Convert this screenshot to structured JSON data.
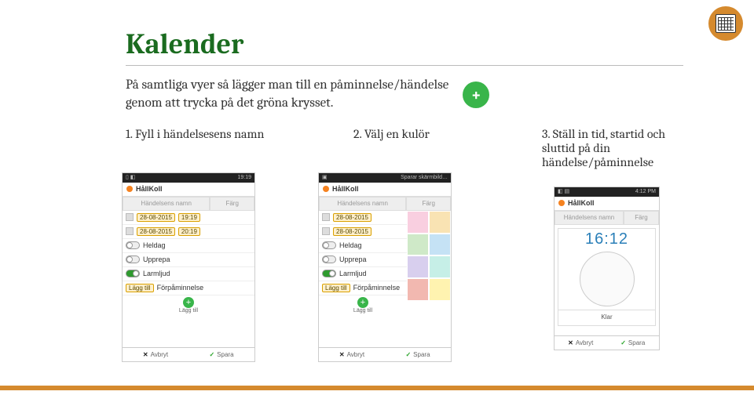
{
  "corner_icon": "calendar-icon",
  "title": "Kalender",
  "intro_line1": "På samtliga vyer så lägger man till en påminnelse/händelse",
  "intro_line2": "genom att trycka på det gröna krysset.",
  "plus_glyph": "+",
  "captions": {
    "c1": "1. Fyll i händelsesens namn",
    "c2": "2. Välj en kulör",
    "c3": "3. Ställ in tid, startid och sluttid på din händelse/påminnelse"
  },
  "phone_a": {
    "status_time": "19:19",
    "app": "HållKoll",
    "tab_name": "Händelsens namn",
    "tab_color": "Färg",
    "r1_date": "28-08-2015",
    "r1_time": "19:19",
    "r2_date": "28-08-2015",
    "r2_time": "20:19",
    "opt_heldag": "Heldag",
    "opt_upprepa": "Upprepa",
    "opt_larmljud": "Larmljud",
    "opt_forpaminnelse": "Förpåminnelse",
    "lagg_till_chip": "Lägg till",
    "lagg_till": "Lägg till",
    "avbryt": "Avbryt",
    "spara": "Spara"
  },
  "phone_b": {
    "status_label": "Sparar skärmbild…",
    "app": "HållKoll",
    "tab_name": "Händelsens namn",
    "tab_color": "Färg",
    "r1_date": "28-08-2015",
    "r2_date": "28-08-2015",
    "opt_heldag": "Heldag",
    "opt_upprepa": "Upprepa",
    "opt_larmljud": "Larmljud",
    "opt_forpaminnelse": "Förpåminnelse",
    "lagg_till_chip": "Lägg till",
    "lagg_till": "Lägg till",
    "avbryt": "Avbryt",
    "spara": "Spara",
    "swatch_colors": [
      "#f9cfe0",
      "#f9e3b3",
      "#cfe9c8",
      "#c5e2f5",
      "#d8cfee",
      "#c6efe7",
      "#f2b8b0",
      "#fff3b0"
    ]
  },
  "phone_c": {
    "status_time": "4:12 PM",
    "app": "HållKoll",
    "tab_name": "Händelsens namn",
    "tab_color": "Färg",
    "big_time": "16:12",
    "klar": "Klar",
    "avbryt": "Avbryt",
    "spara": "Spara"
  }
}
